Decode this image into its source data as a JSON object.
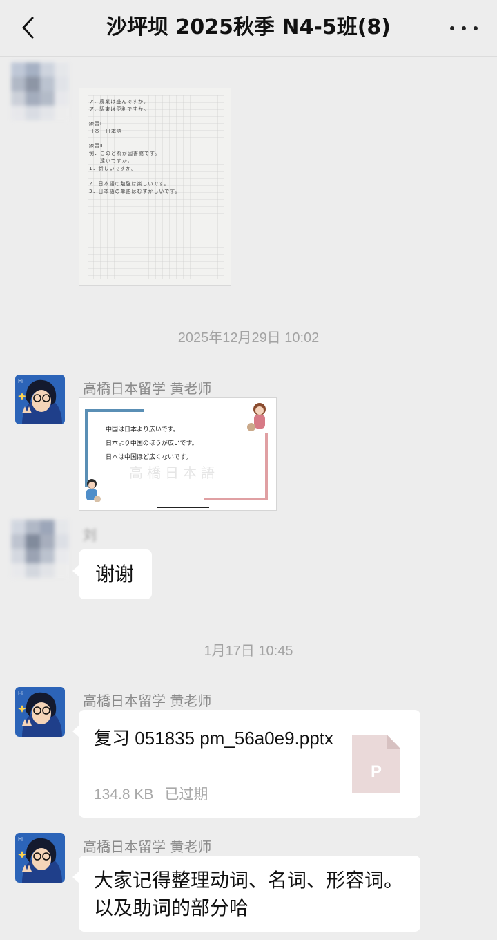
{
  "header": {
    "title": "沙坪坝 2025秋季 N4-5班(8)"
  },
  "messages": [
    {
      "type": "image",
      "sender": "",
      "image_desc": "handwritten homework on grid paper",
      "handwritten_lines": [
        "ア．農業は盛んですか。",
        "ア．駅東は便利ですか。",
        "練習Ⅰ",
        "日本　日本語",
        "練習Ⅱ",
        "例．このどれが図書館です。",
        "　　遠いですか。",
        "1．新しいですか。",
        "2．日本語の勉強は楽しいです。",
        "3．日本語の単語はむずかしいです。"
      ]
    },
    {
      "type": "timestamp",
      "text": "2025年12月29日 10:02"
    },
    {
      "type": "image",
      "sender": "高橋日本留学 黄老师",
      "slide": {
        "lines": [
          "中国は日本より広いです。",
          "日本より中国のほうが広いです。",
          "日本は中国ほど広くないです。"
        ],
        "watermark": "高橋日本語"
      }
    },
    {
      "type": "text",
      "sender": "刘",
      "text": "谢谢"
    },
    {
      "type": "timestamp",
      "text": "1月17日 10:45"
    },
    {
      "type": "file",
      "sender": "高橋日本留学 黄老师",
      "file_name": "复习 051835 pm_56a0e9.pptx",
      "file_size": "134.8 KB",
      "file_status": "已过期",
      "file_icon_letter": "P"
    },
    {
      "type": "text",
      "sender": "高橋日本留学 黄老师",
      "text": "大家记得整理动词、名词、形容词。以及助词的部分哈"
    }
  ],
  "colors": {
    "background": "#ededed",
    "bubble": "#ffffff",
    "meta_text": "#a3a3a3",
    "file_icon": "#ead9d9"
  },
  "icons": {
    "back": "chevron-left-icon",
    "more": "more-dots-icon",
    "file": "pptx-file-icon"
  }
}
